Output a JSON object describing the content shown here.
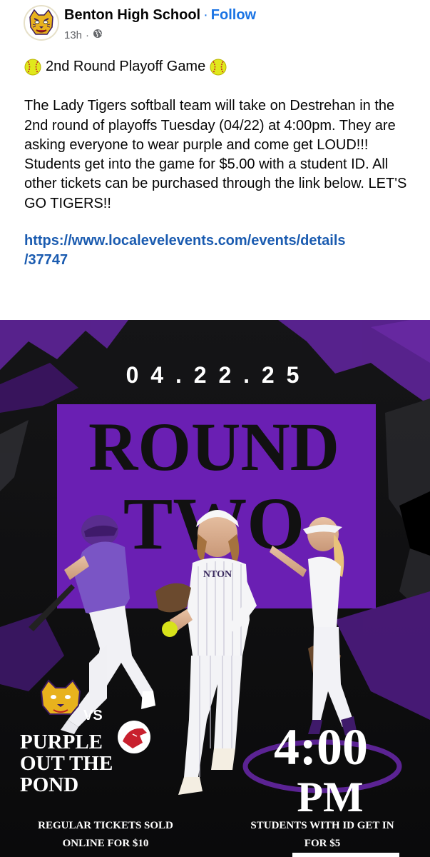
{
  "post": {
    "author": "Benton High School",
    "separator": "·",
    "follow_label": "Follow",
    "time": "13h",
    "time_separator": "·",
    "headline": "2nd Round Playoff Game",
    "paragraph": "The Lady Tigers softball team will take on Destrehan in the 2nd round of playoffs Tuesday (04/22) at 4:00pm. They are asking everyone to wear purple and come get LOUD!!! Students get into the game for $5.00 with a student ID. All other tickets can be purchased through the link below. LET'S GO TIGERS!!",
    "link_line1": "https://www.localevelevents.com/events/details",
    "link_line2": "/37747"
  },
  "flyer": {
    "date": "0 4 . 2 2 . 2 5",
    "round": "ROUND",
    "two": "TWO",
    "vs": "VS",
    "slogan_line1": "PURPLE",
    "slogan_line2": "OUT THE",
    "slogan_line3": "POND",
    "time": "4:00",
    "ampm": "PM",
    "regular_line1": "REGULAR TICKETS SOLD",
    "regular_line2": "ONLINE FOR $10",
    "students_line1": "STUDENTS WITH ID GET IN",
    "students_line2": "FOR $5",
    "jersey_text": "NTON"
  },
  "colors": {
    "purple": "#4b1a78",
    "link": "#1a5bb0",
    "facebook_blue": "#1b74e4",
    "softball": "#d7e21a"
  },
  "icons": [
    "tiger-logo-icon",
    "globe-icon",
    "softball-icon",
    "cougar-logo-icon"
  ]
}
